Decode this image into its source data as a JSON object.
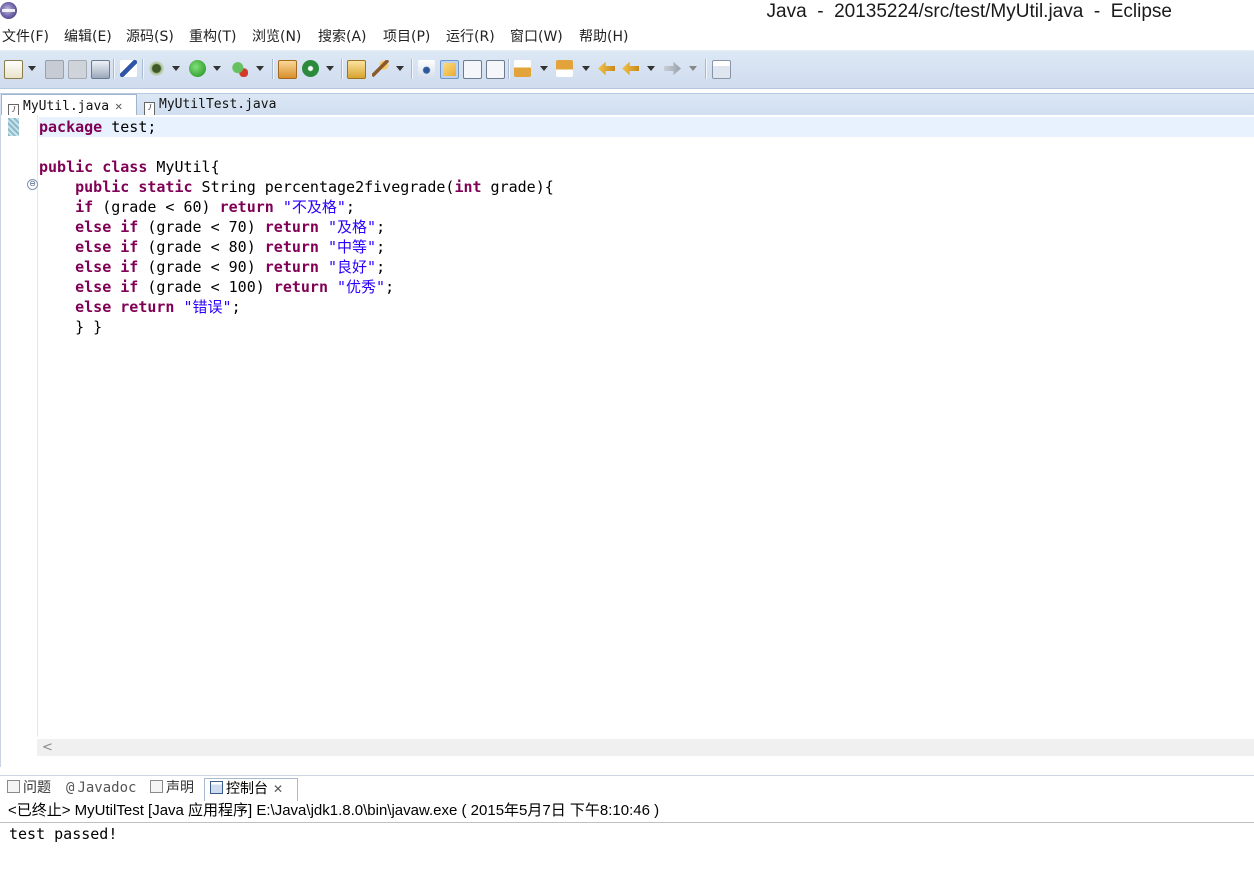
{
  "window": {
    "title": "Java  -  20135224/src/test/MyUtil.java  -  Eclipse"
  },
  "menu": [
    {
      "label": "文件(F)"
    },
    {
      "label": "编辑(E)"
    },
    {
      "label": "源码(S)"
    },
    {
      "label": "重构(T)"
    },
    {
      "label": "浏览(N)"
    },
    {
      "label": "搜索(A)"
    },
    {
      "label": "项目(P)"
    },
    {
      "label": "运行(R)"
    },
    {
      "label": "窗口(W)"
    },
    {
      "label": "帮助(H)"
    }
  ],
  "toolbar": {
    "icons": [
      "new-icon",
      "save-icon",
      "save-all-icon",
      "print-icon",
      "pin-icon",
      "debug-icon",
      "run-icon",
      "external-tools-icon",
      "new-java-package-icon",
      "new-java-class-icon",
      "open-type-icon",
      "search-icon",
      "toggle-breadcrumb-icon",
      "mark-occurrences-icon",
      "block-selection-icon",
      "show-whitespace-icon",
      "next-annotation-icon",
      "previous-annotation-icon",
      "last-edit-icon",
      "back-icon",
      "forward-icon",
      "open-perspective-icon"
    ]
  },
  "editor": {
    "tabs": [
      {
        "label": "MyUtil.java",
        "active": true,
        "closable": true
      },
      {
        "label": "MyUtilTest.java",
        "active": false,
        "closable": false
      }
    ],
    "code_lines": [
      "package test;",
      "",
      "public class MyUtil{",
      "    public static String percentage2fivegrade(int grade){",
      "    if (grade < 60) return \"不及格\";",
      "    else if (grade < 70) return \"及格\";",
      "    else if (grade < 80) return \"中等\";",
      "    else if (grade < 90) return \"良好\";",
      "    else if (grade < 100) return \"优秀\";",
      "    else return \"错误\";",
      "    } }"
    ],
    "fold_marker": "⊖",
    "scroll_arrow": "<"
  },
  "bottom_panel": {
    "tabs": [
      {
        "label": "问题",
        "icon": "problems-icon"
      },
      {
        "label": "Javadoc",
        "icon": "javadoc-icon",
        "prefix": "@"
      },
      {
        "label": "声明",
        "icon": "declaration-icon"
      },
      {
        "label": "控制台",
        "icon": "console-icon",
        "active": true
      }
    ],
    "console_header": "<已终止> MyUtilTest [Java 应用程序] E:\\Java\\jdk1.8.0\\bin\\javaw.exe ( 2015年5月7日 下午8:10:46 )",
    "console_output": "test passed!"
  },
  "colors": {
    "keyword": "#7f0055",
    "string": "#2a00ff",
    "toolbar_bg": "#d6e2f1",
    "current_line": "#e8f2fe"
  }
}
